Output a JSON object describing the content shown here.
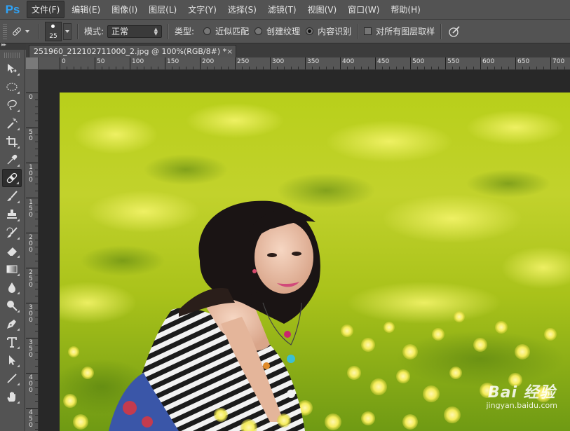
{
  "app": {
    "logo": "Ps"
  },
  "menu": [
    {
      "label": "文件(F)",
      "active": true
    },
    {
      "label": "编辑(E)"
    },
    {
      "label": "图像(I)"
    },
    {
      "label": "图层(L)"
    },
    {
      "label": "文字(Y)"
    },
    {
      "label": "选择(S)"
    },
    {
      "label": "滤镜(T)"
    },
    {
      "label": "视图(V)"
    },
    {
      "label": "窗口(W)"
    },
    {
      "label": "帮助(H)"
    }
  ],
  "options": {
    "brush_size": "25",
    "mode_label": "模式:",
    "mode_value": "正常",
    "type_label": "类型:",
    "type_options": [
      {
        "label": "近似匹配",
        "selected": false
      },
      {
        "label": "创建纹理",
        "selected": false
      },
      {
        "label": "内容识别",
        "selected": true
      }
    ],
    "sample_all_layers": {
      "label": "对所有图层取样",
      "checked": false
    }
  },
  "document": {
    "tab_title": "251960_212102711000_2.jpg @ 100%(RGB/8#) *",
    "close_glyph": "×"
  },
  "ruler": {
    "h_labels": [
      "0",
      "50",
      "100",
      "150",
      "200",
      "250",
      "300",
      "350",
      "400",
      "450",
      "500",
      "550",
      "600",
      "650",
      "700"
    ],
    "v_labels": [
      "0",
      "50",
      "100",
      "150",
      "200",
      "250",
      "300",
      "350",
      "400",
      "450"
    ]
  },
  "watermark": {
    "logo": "Bai 经验",
    "sub": "jingyan.baidu.com"
  },
  "colors": {
    "accent": "#2fa3f7",
    "ui_bg": "#535353",
    "canvas_bg": "#282828"
  }
}
